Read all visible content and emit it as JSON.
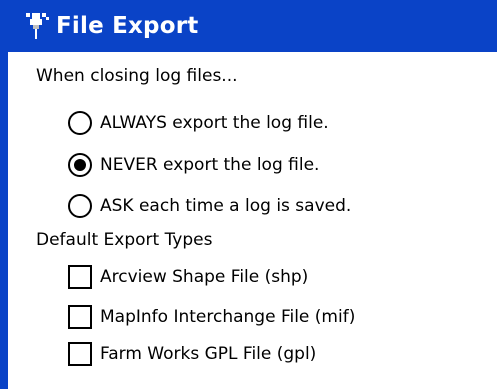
{
  "window": {
    "title": "File Export",
    "icon": "app-pushpin-icon"
  },
  "closing_section": {
    "heading": "When closing log files...",
    "options": [
      {
        "label": "ALWAYS export the log file.",
        "selected": false
      },
      {
        "label": "NEVER export the log file.",
        "selected": true
      },
      {
        "label": "ASK each time a log is saved.",
        "selected": false
      }
    ]
  },
  "export_types_section": {
    "heading": "Default Export Types",
    "items": [
      {
        "label": "Arcview Shape File (shp)",
        "checked": false
      },
      {
        "label": "MapInfo Interchange File (mif)",
        "checked": false
      },
      {
        "label": "Farm Works GPL File (gpl)",
        "checked": false
      }
    ]
  },
  "colors": {
    "titlebar": "#0a43c7",
    "title_text": "#ffffff",
    "background": "#ffffff"
  }
}
